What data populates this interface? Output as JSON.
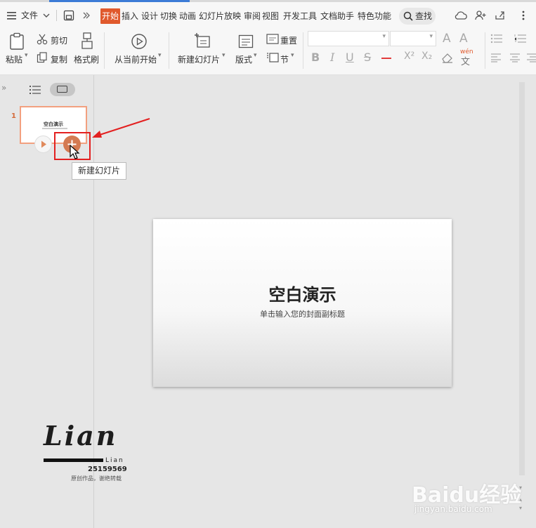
{
  "menu": {
    "file_label": "文件",
    "tabs": [
      {
        "label": "开始",
        "active": true
      },
      {
        "label": "插入"
      },
      {
        "label": "设计"
      },
      {
        "label": "切换"
      },
      {
        "label": "动画"
      },
      {
        "label": "幻灯片放映"
      },
      {
        "label": "审阅"
      },
      {
        "label": "视图"
      },
      {
        "label": "开发工具"
      },
      {
        "label": "文档助手"
      },
      {
        "label": "特色功能"
      }
    ],
    "search_label": "查找"
  },
  "ribbon": {
    "paste_label": "粘贴",
    "cut_label": "剪切",
    "copy_label": "复制",
    "format_painter_label": "格式刷",
    "from_current_label": "从当前开始",
    "new_slide_label": "新建幻灯片",
    "layout_label": "版式",
    "reset_label": "重置",
    "section_label": "节",
    "font_size_up": "A",
    "font_size_down": "A",
    "bold": "B",
    "italic": "I",
    "underline": "U",
    "strike": "S",
    "superscript": "X²",
    "subscript": "X₂",
    "pinyin": "wén"
  },
  "thumbnails": [
    {
      "number": "1",
      "title": "空白演示"
    }
  ],
  "tooltip": "新建幻灯片",
  "slide": {
    "title": "空白演示",
    "subtitle": "单击输入您的封面副标题"
  },
  "watermark": {
    "signature": "Lian",
    "name": "Lian",
    "id": "25159569",
    "note": "原创作品，谢绝转载"
  },
  "site_watermark": {
    "logo": "Baidu经验",
    "url": "jingyan.baidu.com"
  },
  "colors": {
    "accent": "#e0592c",
    "add_button": "#d47a52",
    "annotation": "#e32020"
  }
}
